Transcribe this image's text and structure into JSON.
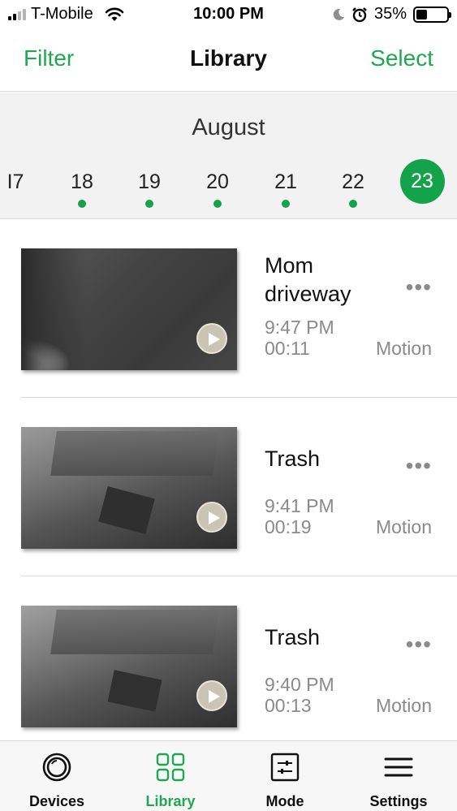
{
  "status_bar": {
    "carrier": "T-Mobile",
    "time": "10:00 PM",
    "battery_percent": "35%",
    "battery_level": 0.35
  },
  "nav": {
    "left_label": "Filter",
    "title": "Library",
    "right_label": "Select"
  },
  "date_strip": {
    "month": "August",
    "days": [
      {
        "label": "I7",
        "has_dot": false,
        "selected": false
      },
      {
        "label": "18",
        "has_dot": true,
        "selected": false
      },
      {
        "label": "19",
        "has_dot": true,
        "selected": false
      },
      {
        "label": "20",
        "has_dot": true,
        "selected": false
      },
      {
        "label": "21",
        "has_dot": true,
        "selected": false
      },
      {
        "label": "22",
        "has_dot": true,
        "selected": false
      },
      {
        "label": "23",
        "has_dot": false,
        "selected": true
      }
    ]
  },
  "clips": [
    {
      "title": "Mom driveway",
      "time": "9:47 PM",
      "duration": "00:11",
      "type": "Motion",
      "more": "•••"
    },
    {
      "title": "Trash",
      "time": "9:41 PM",
      "duration": "00:19",
      "type": "Motion",
      "more": "•••"
    },
    {
      "title": "Trash",
      "time": "9:40 PM",
      "duration": "00:13",
      "type": "Motion",
      "more": "•••"
    }
  ],
  "tabs": [
    {
      "label": "Devices",
      "icon": "camera-ring-icon",
      "active": false
    },
    {
      "label": "Library",
      "icon": "grid-icon",
      "active": true
    },
    {
      "label": "Mode",
      "icon": "sliders-icon",
      "active": false
    },
    {
      "label": "Settings",
      "icon": "menu-icon",
      "active": false
    }
  ],
  "colors": {
    "accent": "#1fa84f",
    "selected_day": "#14a34b",
    "secondary_text": "#8a8a8a"
  }
}
